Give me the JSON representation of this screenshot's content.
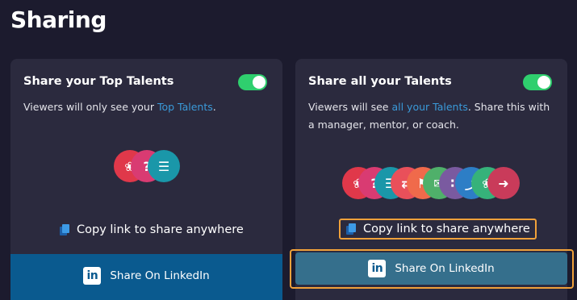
{
  "page": {
    "title": "Sharing"
  },
  "cards": {
    "top": {
      "title": "Share your Top Talents",
      "desc_prefix": "Viewers will only see your ",
      "desc_link": "Top Talents",
      "desc_suffix": ".",
      "toggle_on": true,
      "copy_label": "Copy link to share anywhere",
      "linkedin_label": "Share On LinkedIn",
      "linkedin_icon": "in"
    },
    "all": {
      "title": "Share all your Talents",
      "desc_prefix": "Viewers will see ",
      "desc_link": "all your Talents",
      "desc_suffix": ". Share this with a manager, mentor, or coach.",
      "toggle_on": true,
      "copy_label": "Copy link to share anywhere",
      "linkedin_label": "Share On LinkedIn",
      "linkedin_icon": "in"
    }
  },
  "badges": {
    "top": [
      {
        "name": "lightbulb-badge-icon",
        "color": "#e0384a",
        "glyph": "❀"
      },
      {
        "name": "question-badge-icon",
        "color": "#d93b72",
        "glyph": "?"
      },
      {
        "name": "list-badge-icon",
        "color": "#1a97a9",
        "glyph": "☰"
      }
    ],
    "all": [
      {
        "name": "lightbulb-badge-icon",
        "color": "#e0384a",
        "glyph": "❀"
      },
      {
        "name": "question-badge-icon",
        "color": "#d93b72",
        "glyph": "?"
      },
      {
        "name": "list-badge-icon",
        "color": "#1a97a9",
        "glyph": "☰"
      },
      {
        "name": "arrows-badge-icon",
        "color": "#e9505a",
        "glyph": "⇄"
      },
      {
        "name": "figure-badge-icon",
        "color": "#f06a4b",
        "glyph": "⚑"
      },
      {
        "name": "chat-badge-icon",
        "color": "#4fb06a",
        "glyph": "✉"
      },
      {
        "name": "dots-badge-icon",
        "color": "#7a5aa0",
        "glyph": "∷"
      },
      {
        "name": "path-badge-icon",
        "color": "#2d7ec6",
        "glyph": "⤴"
      },
      {
        "name": "spiral-badge-icon",
        "color": "#36b27a",
        "glyph": "❀"
      },
      {
        "name": "arrow-badge-icon",
        "color": "#c93b5a",
        "glyph": "➜"
      }
    ]
  },
  "colors": {
    "background": "#1c1b2e",
    "card": "#2b2a3e",
    "accent_link": "#3a9ad9",
    "toggle": "#2fcf6e",
    "linkedin": "#0a5a8f",
    "highlight": "#f0a13a"
  }
}
